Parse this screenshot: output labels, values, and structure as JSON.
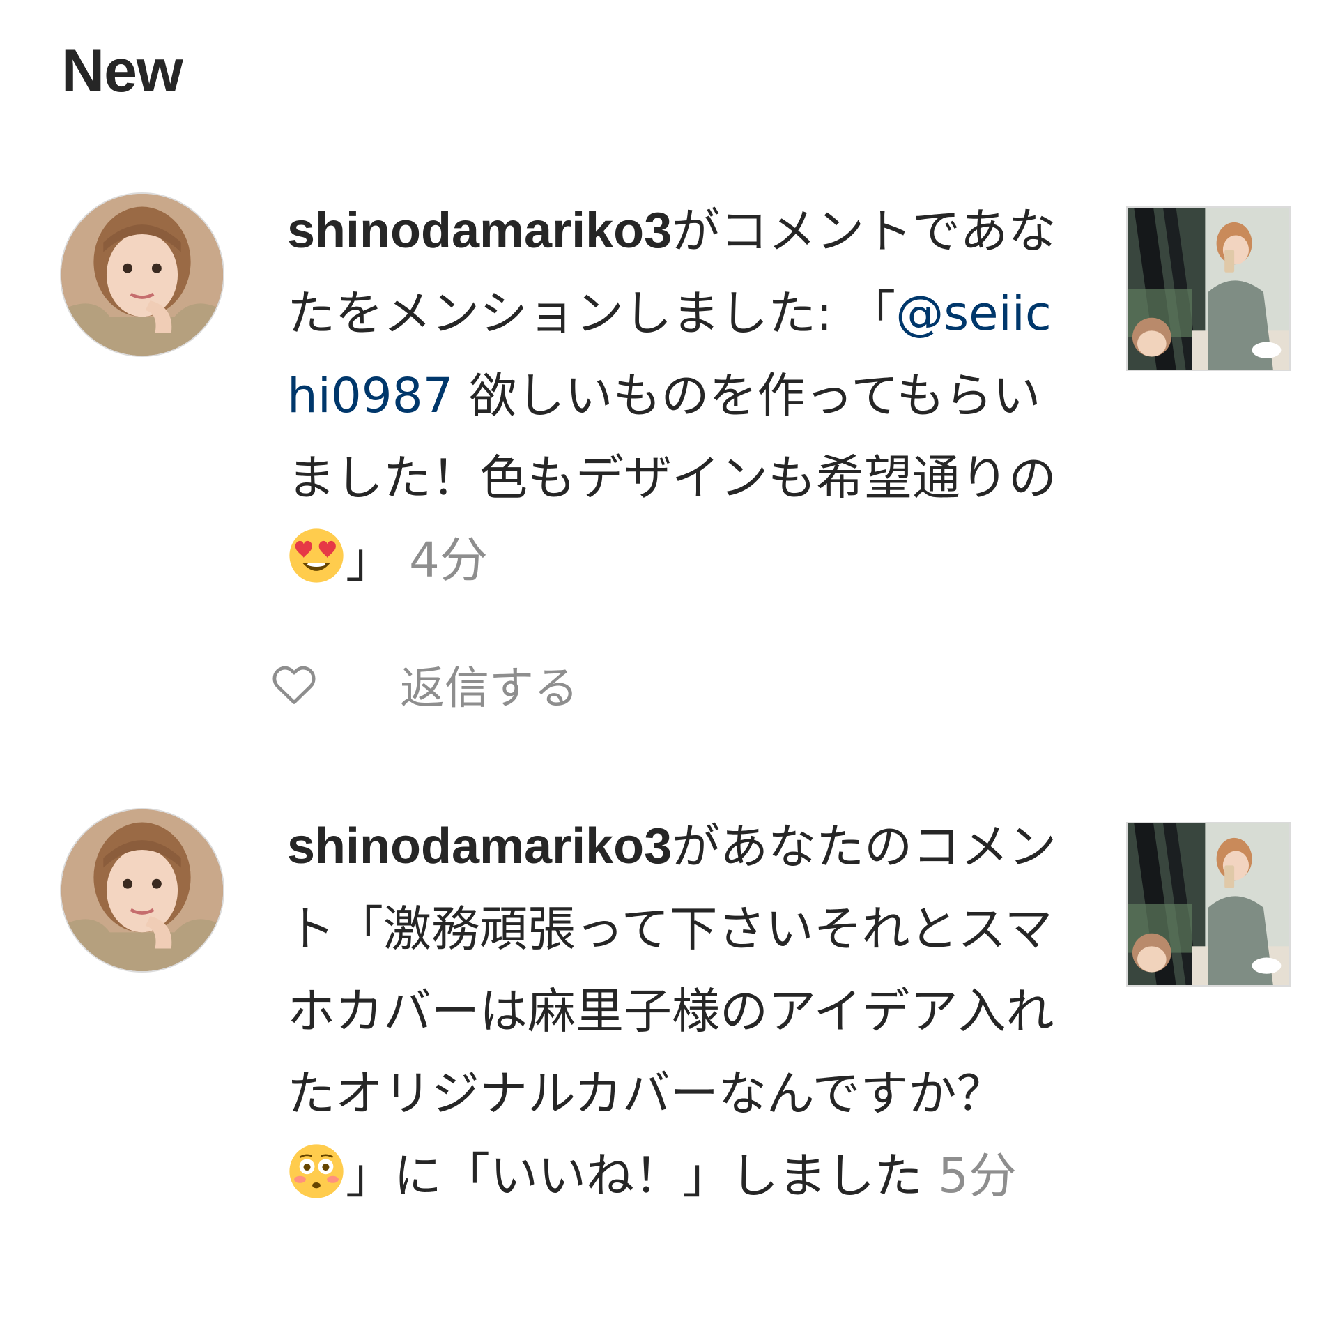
{
  "section": {
    "title": "New"
  },
  "notifications": [
    {
      "username": "shinodamariko3",
      "message_before": "がコメントであなたをメンションしました: 「",
      "mention": "@seiichi0987",
      "message_after": " 欲しいものを作ってもらいました！色もデザインも希望通りの",
      "emoji": "heart-eyes-emoji",
      "message_end": "」 ",
      "time": "4分",
      "reply_label": "返信する",
      "like_icon": "heart-outline-icon"
    },
    {
      "username": "shinodamariko3",
      "message_before": "があなたのコメント「激務頑張って下さいそれとスマホカバーは麻里子様のアイデア入れたオリジナルカバーなんですか？",
      "emoji": "flushed-face-emoji",
      "message_end": "」に「いいね！」しました ",
      "time": "5分"
    }
  ],
  "colors": {
    "text": "#262626",
    "mention": "#00376b",
    "secondary": "#8e8e8e"
  }
}
